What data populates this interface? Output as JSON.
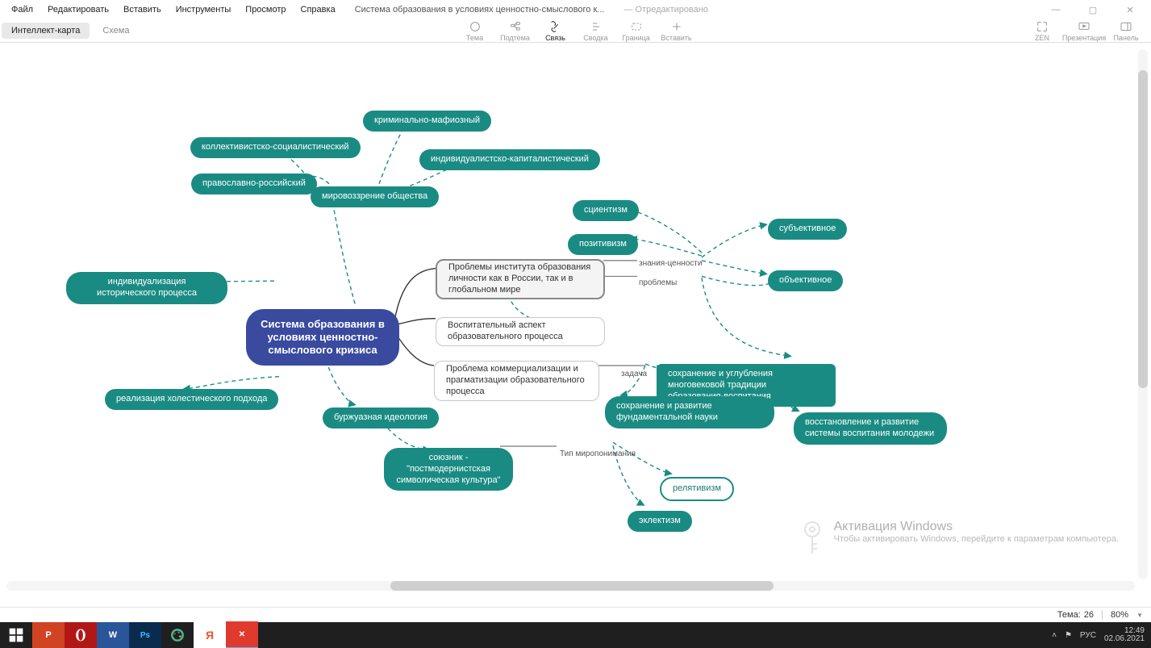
{
  "menu": {
    "file": "Файл",
    "edit": "Редактировать",
    "insert": "Вставить",
    "tools": "Инструменты",
    "view": "Просмотр",
    "help": "Справка"
  },
  "doc": {
    "title": "Система образования в условиях ценностно-смыслового к...",
    "status": "— Отредактировано"
  },
  "wincontrols": {
    "min": "—",
    "max": "▢",
    "close": "✕"
  },
  "tabs": {
    "mindmap": "Интеллект-карта",
    "outline": "Схема"
  },
  "toolbar": {
    "theme": "Тема",
    "subtopic": "Подтема",
    "link": "Связь",
    "summary": "Сводка",
    "boundary": "Граница",
    "insert": "Вставить",
    "zen": "ZEN",
    "present": "Презентация",
    "panel": "Панель"
  },
  "status": {
    "topic_count_label": "Тема:",
    "topic_count": "26",
    "zoom": "80%"
  },
  "watermark": {
    "title": "Активация Windows",
    "sub": "Чтобы активировать Windows, перейдите к параметрам компьютера."
  },
  "tray": {
    "lang": "РУС",
    "time": "12:49",
    "date": "02.06.2021"
  },
  "labels": {
    "zn": "знания-ценности",
    "pr": "проблемы",
    "task": "задача",
    "worldtype": "Тип миропонимания"
  },
  "nodes": {
    "central": "Система образования в условиях ценностно-смыслового кризиса",
    "p1": "Проблемы института образования личности как в России, так и в глобальном мире",
    "p2": "Воспитательный аспект образовательного процесса",
    "p3": "Проблема коммерциализации и прагматизации образовательного процесса",
    "world": "мировоззрение общества",
    "w1": "коллективистско-социалистический",
    "w2": "православно-российский",
    "w3": "криминально-мафиозный",
    "w4": "индивидуалистско-капиталистический",
    "sci": "сциентизм",
    "pos": "позитивизм",
    "subj": "субъективное",
    "obj": "объективное",
    "indiv": "индивидуализация  исторического процесса",
    "holi": "реализация холестического подхода",
    "bourg": "буржуазная идеология",
    "ally": "союзник - \"постмодернистская символическая культура\"",
    "rel": "релятивизм",
    "ecl": "эклектизм",
    "task1": "сохранение и углубления многовековой традиции образования-воспитания",
    "task2": "сохранение и развитие фундаментальной науки",
    "task3": "восстановление и развитие системы воспитания молодежи"
  }
}
